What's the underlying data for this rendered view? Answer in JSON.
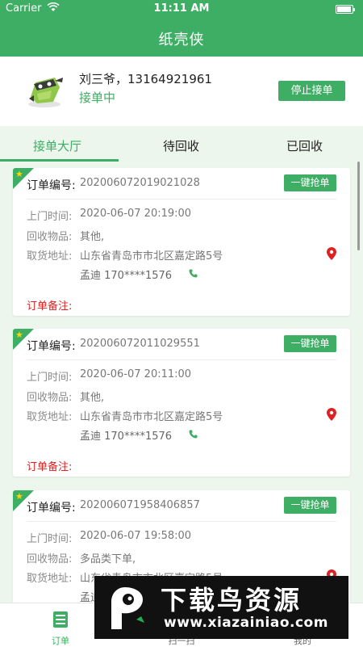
{
  "status_bar": {
    "carrier": "Carrier",
    "time": "11:11 AM"
  },
  "app": {
    "title": "纸壳侠"
  },
  "profile": {
    "name_phone": "刘三爷，13164921961",
    "status": "接单中",
    "stop_button": "停止接单"
  },
  "tabs": [
    {
      "label": "接单大厅",
      "active": true
    },
    {
      "label": "待回收",
      "active": false
    },
    {
      "label": "已回收",
      "active": false
    }
  ],
  "order_labels": {
    "order_no": "订单编号:",
    "visit_time": "上门时间:",
    "items": "回收物品:",
    "address": "取货地址:",
    "remark": "订单备注:",
    "grab_button": "一键抢单"
  },
  "orders": [
    {
      "order_no": "202006072019021028",
      "visit_time": "2020-06-07 20:19:00",
      "items": "其他,",
      "address": "山东省青岛市市北区嘉定路5号",
      "contact": "孟迪 170****1576"
    },
    {
      "order_no": "202006072011029551",
      "visit_time": "2020-06-07 20:11:00",
      "items": "其他,",
      "address": "山东省青岛市市北区嘉定路5号",
      "contact": "孟迪 170****1576"
    },
    {
      "order_no": "202006071958406857",
      "visit_time": "2020-06-07 19:58:00",
      "items": "多品类下单,",
      "address": "山东省青岛市市北区嘉定路5号",
      "contact": "孟迪"
    }
  ],
  "bottom_nav": [
    {
      "label": "订单",
      "icon": "order-list-icon",
      "active": true
    },
    {
      "label": "扫一扫",
      "icon": "scan-icon",
      "active": false
    },
    {
      "label": "我的",
      "icon": "profile-icon",
      "active": false
    }
  ],
  "watermark": {
    "title": "下载鸟资源",
    "url": "www.xiazainiao.com"
  },
  "colors": {
    "accent": "#3dae64",
    "background": "#ecf6ec",
    "remark": "#e02020",
    "pin": "#e02020"
  }
}
